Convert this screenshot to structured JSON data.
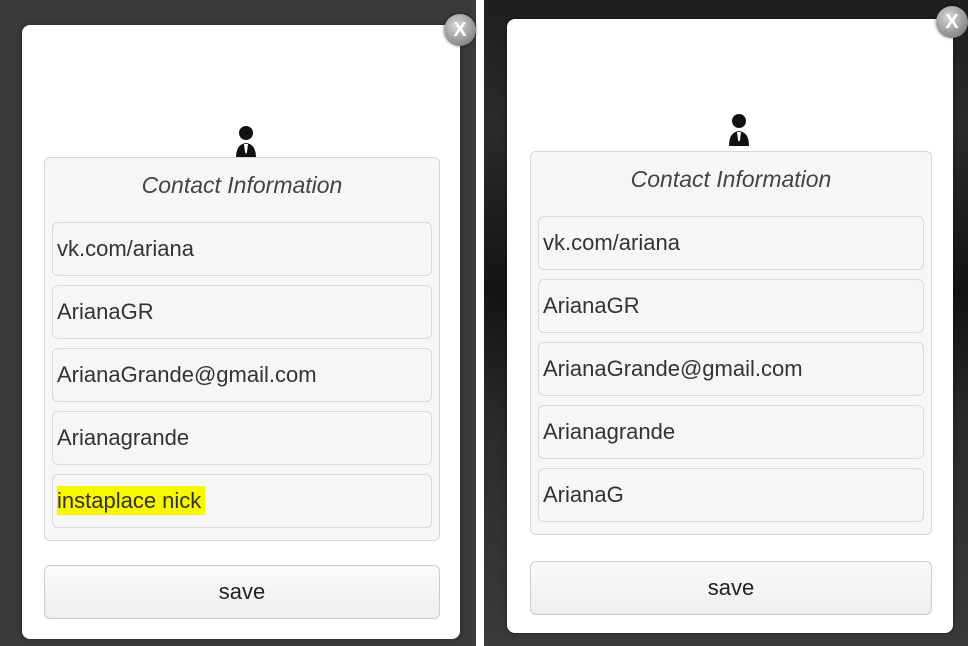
{
  "close_label": "X",
  "accent_highlight": "#f7f700",
  "left_panel": {
    "legend": "Contact Information",
    "fields": [
      {
        "value": "vk.com/ariana",
        "highlighted": false
      },
      {
        "value": "ArianaGR",
        "highlighted": false
      },
      {
        "value": "ArianaGrande@gmail.com",
        "highlighted": false
      },
      {
        "value": "Arianagrande",
        "highlighted": false
      },
      {
        "value": "instaplace nick",
        "highlighted": true
      }
    ],
    "save_label": "save"
  },
  "right_panel": {
    "legend": "Contact Information",
    "fields": [
      {
        "value": "vk.com/ariana",
        "highlighted": false
      },
      {
        "value": "ArianaGR",
        "highlighted": false
      },
      {
        "value": "ArianaGrande@gmail.com",
        "highlighted": false
      },
      {
        "value": "Arianagrande",
        "highlighted": false
      },
      {
        "value": "ArianaG",
        "highlighted": false
      }
    ],
    "save_label": "save"
  }
}
